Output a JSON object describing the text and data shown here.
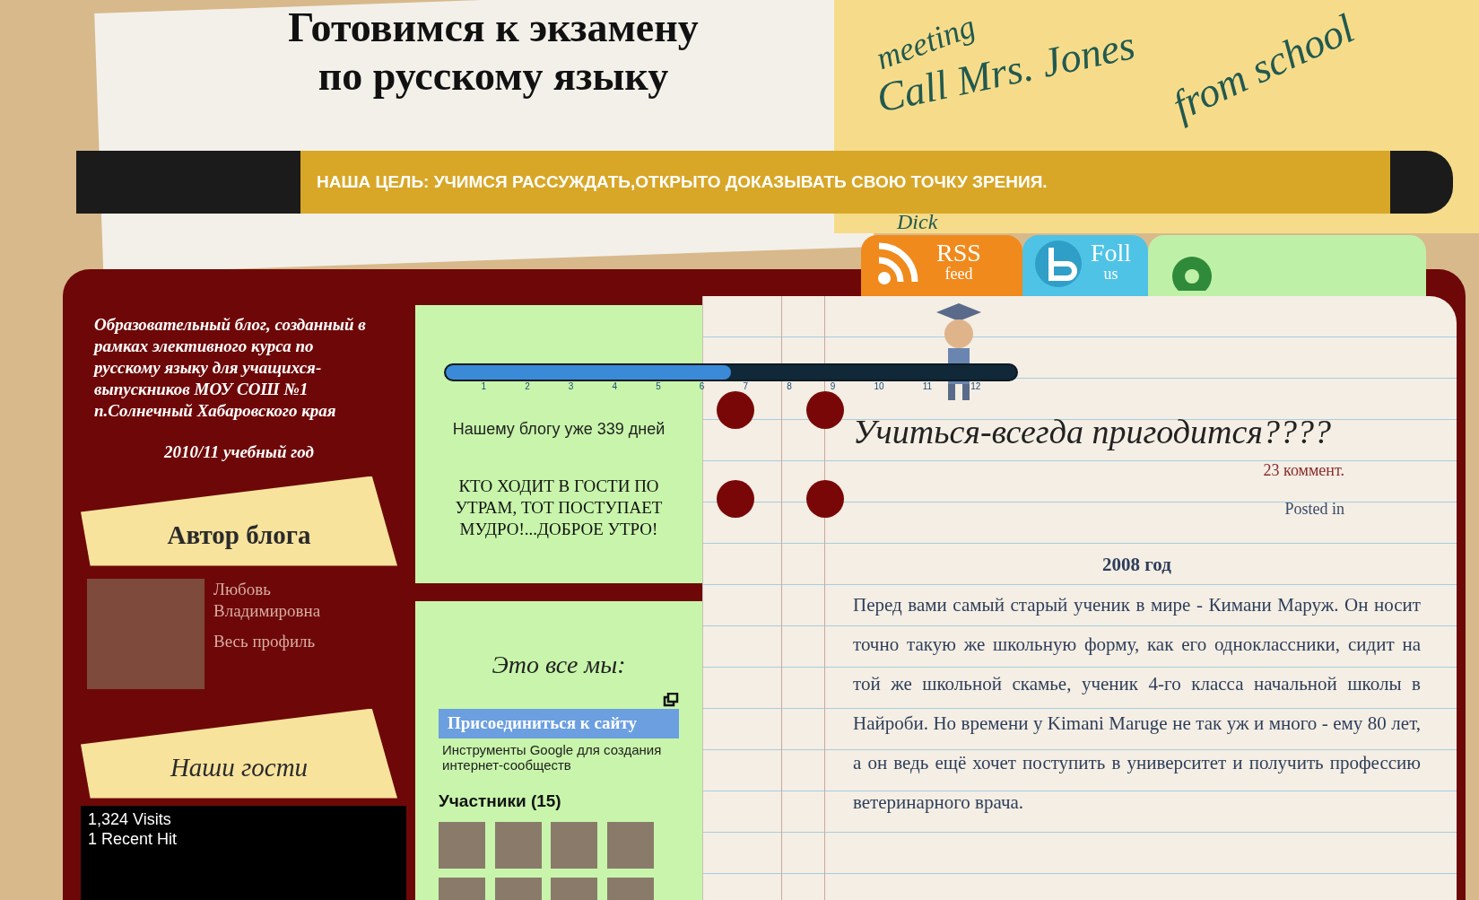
{
  "header": {
    "title": "Готовимся к экзамену по русскому языку",
    "motto": "НАША ЦЕЛЬ: УЧИМСЯ РАССУЖДАТЬ,ОТКРЫТО ДОКАЗЫВАТЬ СВОЮ ТОЧКУ ЗРЕНИЯ.",
    "notes": [
      {
        "kind": "top",
        "text": "meeting"
      },
      {
        "kind": "middle",
        "text": "Call Mrs. Jones"
      },
      {
        "kind": "right",
        "text": "from school"
      },
      {
        "kind": "bottom",
        "text": "Dick"
      }
    ]
  },
  "social_tabs": [
    {
      "kind": "rss",
      "label": "RSS",
      "sublabel": "feed"
    },
    {
      "kind": "twitter",
      "label": "Foll",
      "sublabel": "us"
    },
    {
      "kind": "other"
    }
  ],
  "sidebar": {
    "intro": "Образовательный блог, созданный в рамках элективного курса по русскому языку для учащихся-выпускников МОУ СОШ №1 п.Солнечный Хабаровского края",
    "year": "2010/11 учебный год",
    "author_widget": {
      "heading": "Автор блога",
      "name": "Любовь Владимировна",
      "profile_link": "Весь профиль"
    },
    "guests_widget": {
      "heading": "Наши гости",
      "stats": [
        "1,324 Visits",
        "1 Recent Hit"
      ]
    }
  },
  "counter": {
    "level": 0.5,
    "ticks": [
      "1",
      "2",
      "3",
      "4",
      "5",
      "6",
      "7",
      "8",
      "9",
      "10",
      "11",
      "12"
    ],
    "caption": "Нашему блогу уже 339 дней"
  },
  "quote": "КТО ХОДИТ В ГОСТИ ПО УТРАМ, ТОТ ПОСТУПАЕТ МУДРО!...ДОБРОЕ УТРО!",
  "members": {
    "heading": "Это все мы:",
    "join_button": "Присоединиться к сайту",
    "google_text": "Инструменты Google для создания интернет-сообществ",
    "count_label": "Участники (15)",
    "avatars": [
      {
        "kind": "photo"
      },
      {
        "kind": "photo"
      },
      {
        "kind": "photo"
      },
      {
        "kind": "photo"
      },
      {
        "kind": "photo"
      },
      {
        "kind": "photo"
      },
      {
        "kind": "photo"
      },
      {
        "kind": "photo"
      }
    ]
  },
  "post": {
    "title": "Учиться-всегда пригодится????",
    "comments": "23 коммент.",
    "posted_in": "Posted in",
    "subheading": "2008 год",
    "paragraphs": [
      "Перед вами самый старый ученик в мире - Кимани Маруж. Он носит точно такую же школьную форму, как его одноклассники, сидит на той же школьной скамье, ученик 4-го класса начальной школы в Найроби. Но времени у Kimani Maruge не так уж и много - ему 80 лет, а он ведь ещё хочет поступить в университет и получить профессию ветеринарного врача."
    ]
  }
}
